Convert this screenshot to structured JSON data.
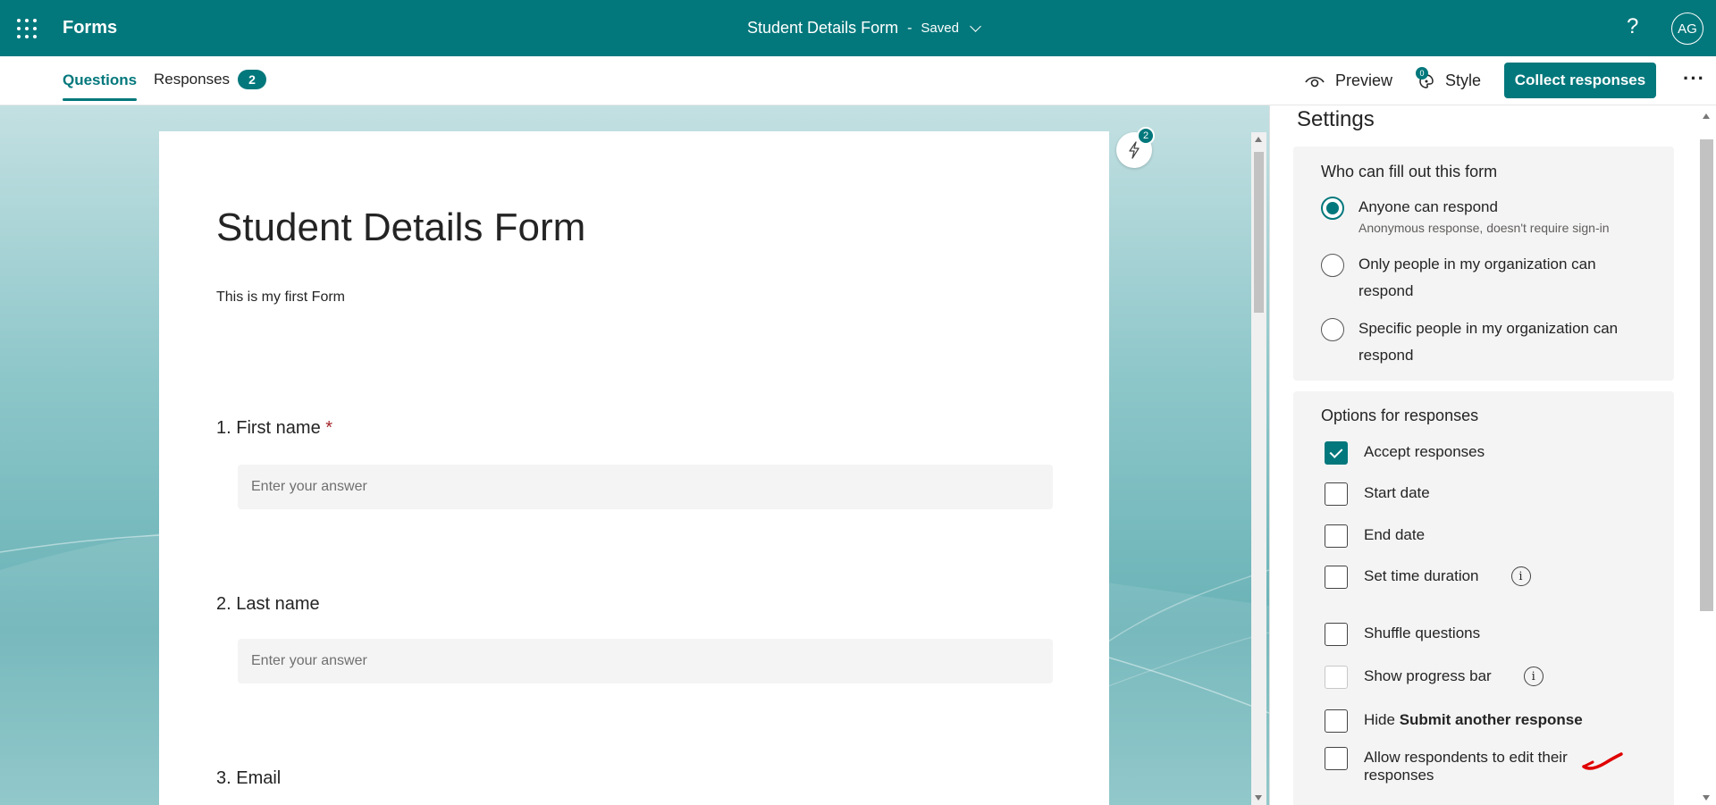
{
  "topbar": {
    "app_name": "Forms",
    "doc_title": "Student Details Form",
    "separator": "-",
    "save_status": "Saved",
    "help_label": "?",
    "avatar_initials": "AG"
  },
  "tabs": {
    "questions": "Questions",
    "responses": "Responses",
    "responses_count": "2"
  },
  "toolbar": {
    "preview_label": "Preview",
    "style_label": "Style",
    "style_badge": "0",
    "collect_label": "Collect responses",
    "more_label": "···"
  },
  "form": {
    "title": "Student Details Form",
    "description": "This is my first Form",
    "insights_badge": "2",
    "questions": [
      {
        "number_label": "1. First name",
        "required_mark": "*",
        "placeholder": "Enter your answer"
      },
      {
        "number_label": "2. Last name",
        "placeholder": "Enter your answer"
      },
      {
        "number_label": "3. Email"
      }
    ]
  },
  "settings": {
    "title": "Settings",
    "who": {
      "heading": "Who can fill out this form",
      "options": [
        {
          "label": "Anyone can respond",
          "sub": "Anonymous response, doesn't require sign-in",
          "selected": true
        },
        {
          "label": "Only people in my organization can respond",
          "selected": false
        },
        {
          "label": "Specific people in my organization can respond",
          "selected": false
        }
      ]
    },
    "options": {
      "heading": "Options for responses",
      "items": [
        {
          "label": "Accept responses",
          "checked": true
        },
        {
          "label": "Start date",
          "checked": false
        },
        {
          "label": "End date",
          "checked": false
        },
        {
          "label": "Set time duration",
          "checked": false,
          "info": "i"
        },
        {
          "label": "Shuffle questions",
          "checked": false
        },
        {
          "label": "Show progress bar",
          "checked": false,
          "info": "i"
        },
        {
          "label_prefix": "Hide ",
          "label_bold": "Submit another response",
          "checked": false
        },
        {
          "label": "Allow respondents to edit their responses",
          "checked": false
        }
      ]
    }
  },
  "colors": {
    "accent": "#03787c",
    "required": "#a4262c",
    "annotation": "#e00000"
  },
  "icons": {
    "app_launcher": "waffle-icon",
    "preview": "eye-icon",
    "style": "palette-icon",
    "insights": "lightning-icon",
    "info": "info-icon"
  }
}
